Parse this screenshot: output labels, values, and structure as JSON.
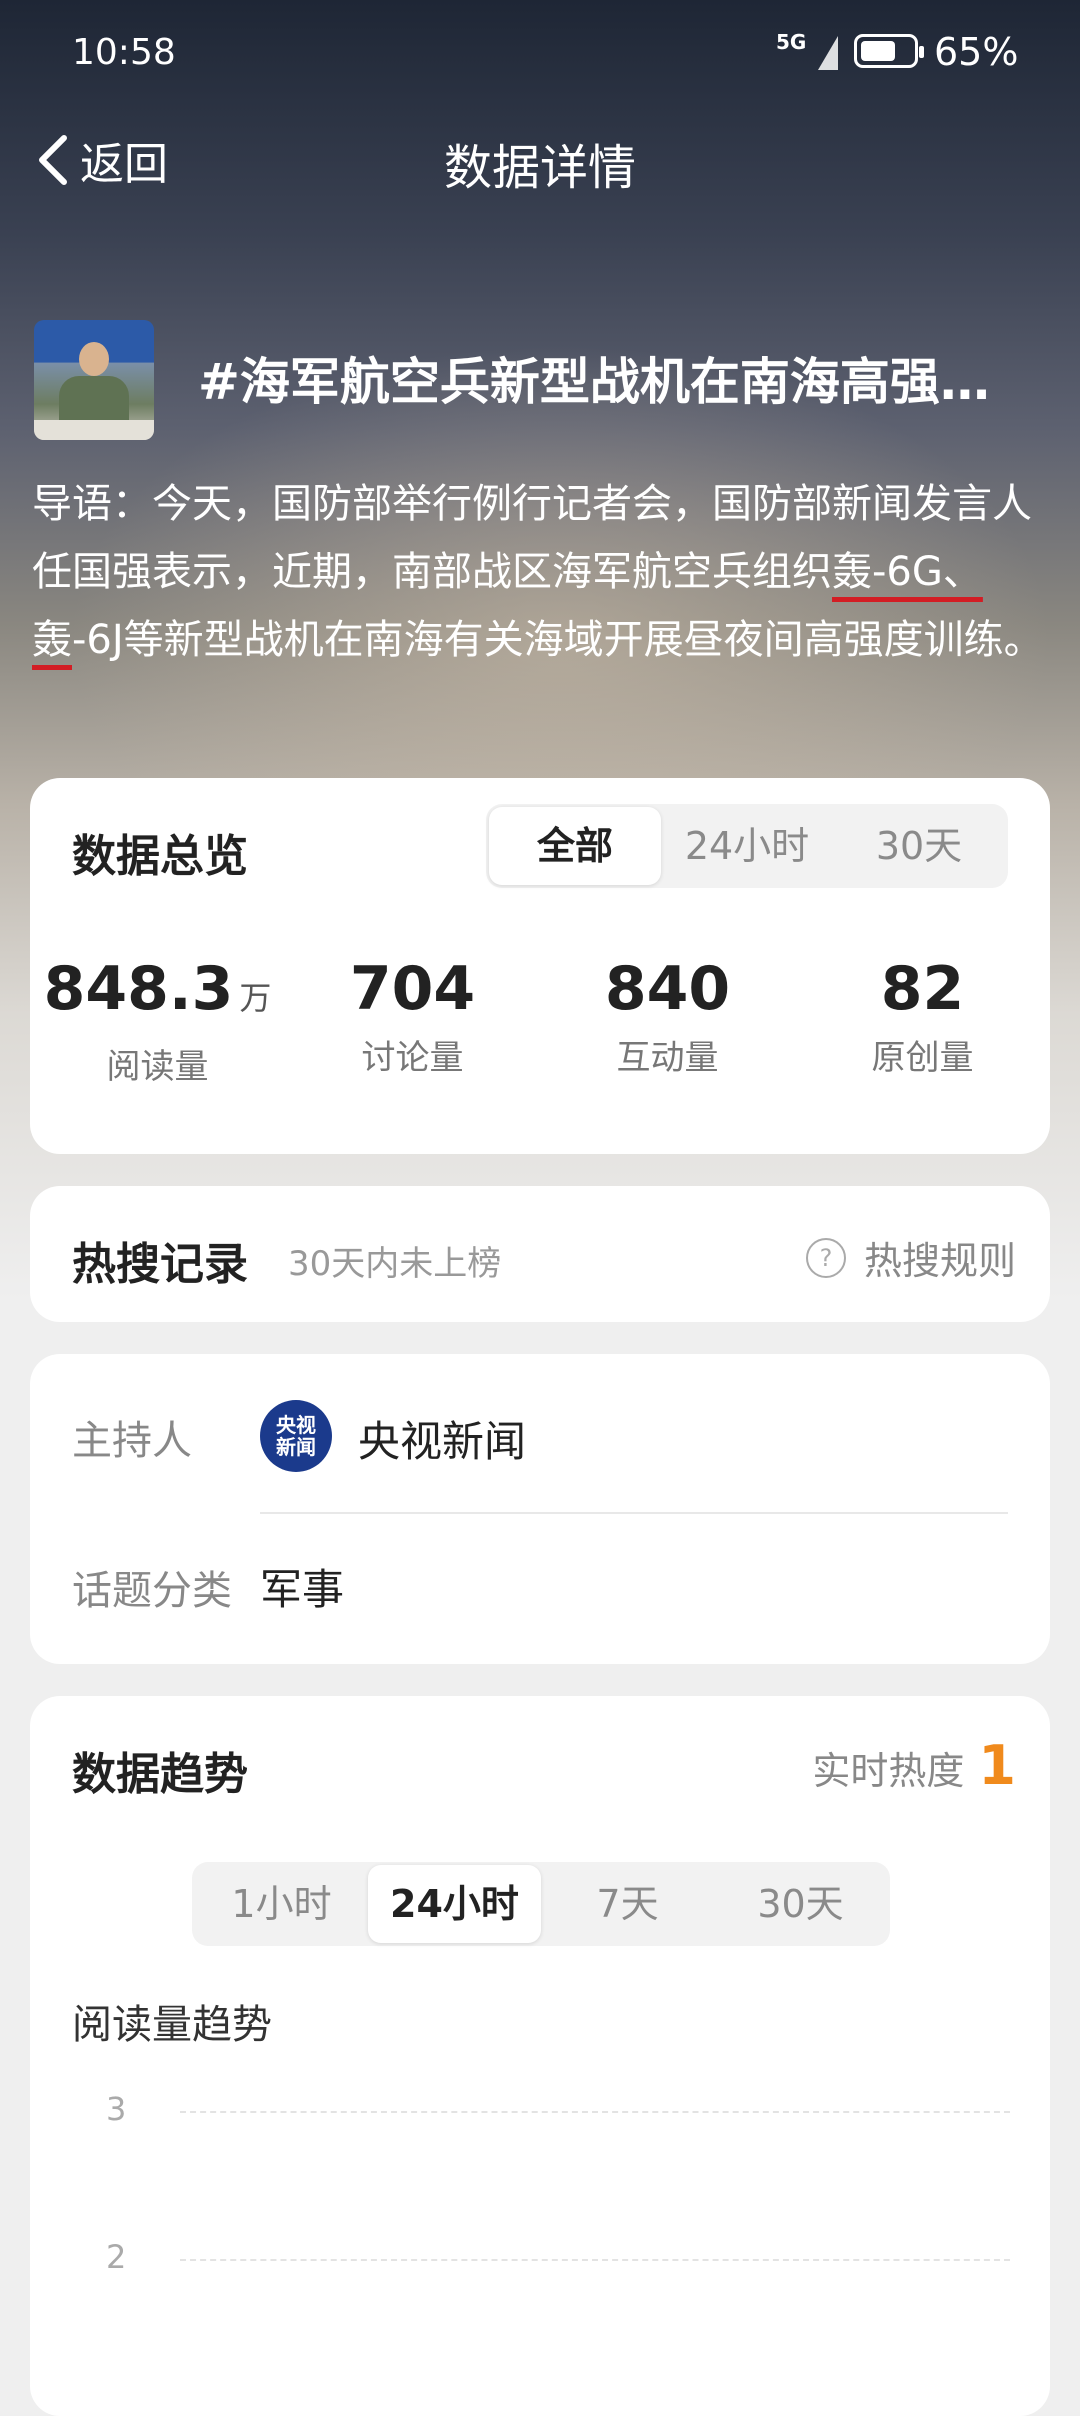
{
  "status_bar": {
    "time": "10:58",
    "network": "5G",
    "battery": "65%"
  },
  "nav": {
    "back_label": "返回",
    "title": "数据详情"
  },
  "topic": {
    "title": "#海军航空兵新型战机在南海高强…",
    "lead_prefix": "导语：今天，国防部举行例行记者会，国防部新闻发言人任国强表示，近期，南部战区海军航空兵组织",
    "lead_mark_1": "轰-6G、",
    "lead_mark_2": "轰",
    "lead_suffix": "-6J等新型战机在南海有关海域开展昼夜间高强度训练。"
  },
  "overview": {
    "title": "数据总览",
    "tabs": [
      {
        "label": "全部"
      },
      {
        "label": "24小时"
      },
      {
        "label": "30天"
      }
    ],
    "stats": [
      {
        "value": "848.3",
        "unit": "万",
        "label": "阅读量"
      },
      {
        "value": "704",
        "unit": "",
        "label": "讨论量"
      },
      {
        "value": "840",
        "unit": "",
        "label": "互动量"
      },
      {
        "value": "82",
        "unit": "",
        "label": "原创量"
      }
    ]
  },
  "hot_search": {
    "title": "热搜记录",
    "subtitle": "30天内未上榜",
    "rule_label": "热搜规则"
  },
  "info": {
    "host_key": "主持人",
    "host_logo_line1": "央视",
    "host_logo_line2": "新闻",
    "host_name": "央视新闻",
    "category_key": "话题分类",
    "category_value": "军事"
  },
  "trend": {
    "title": "数据趋势",
    "heat_label": "实时热度",
    "heat_value": "1",
    "tabs": [
      {
        "label": "1小时"
      },
      {
        "label": "24小时"
      },
      {
        "label": "7天"
      },
      {
        "label": "30天"
      }
    ],
    "chart_label": "阅读量趋势",
    "y_ticks": [
      "3",
      "2"
    ]
  }
}
